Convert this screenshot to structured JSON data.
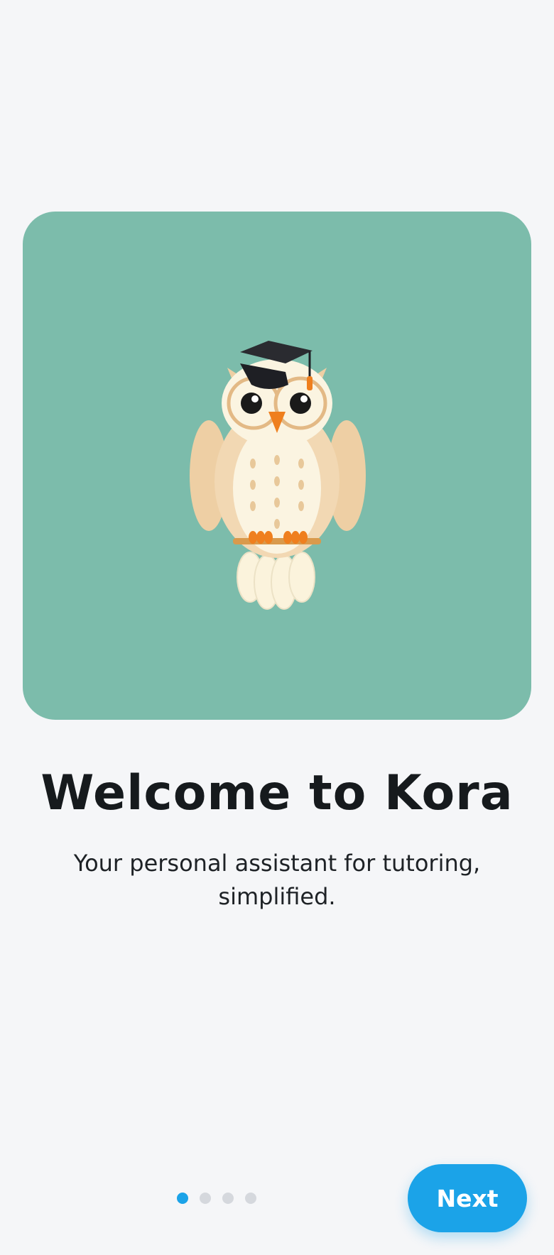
{
  "hero": {
    "illustration": "owl-graduate-illustration",
    "background_color": "#7cbcab"
  },
  "welcome": {
    "title": "Welcome to Kora",
    "subtitle": "Your personal assistant for tutoring, simplified."
  },
  "pagination": {
    "total_pages": 4,
    "current_page": 1,
    "active_color": "#1ba3e8",
    "inactive_color": "#d5d8dd"
  },
  "actions": {
    "next_label": "Next",
    "accent_color": "#1ba3e8"
  }
}
